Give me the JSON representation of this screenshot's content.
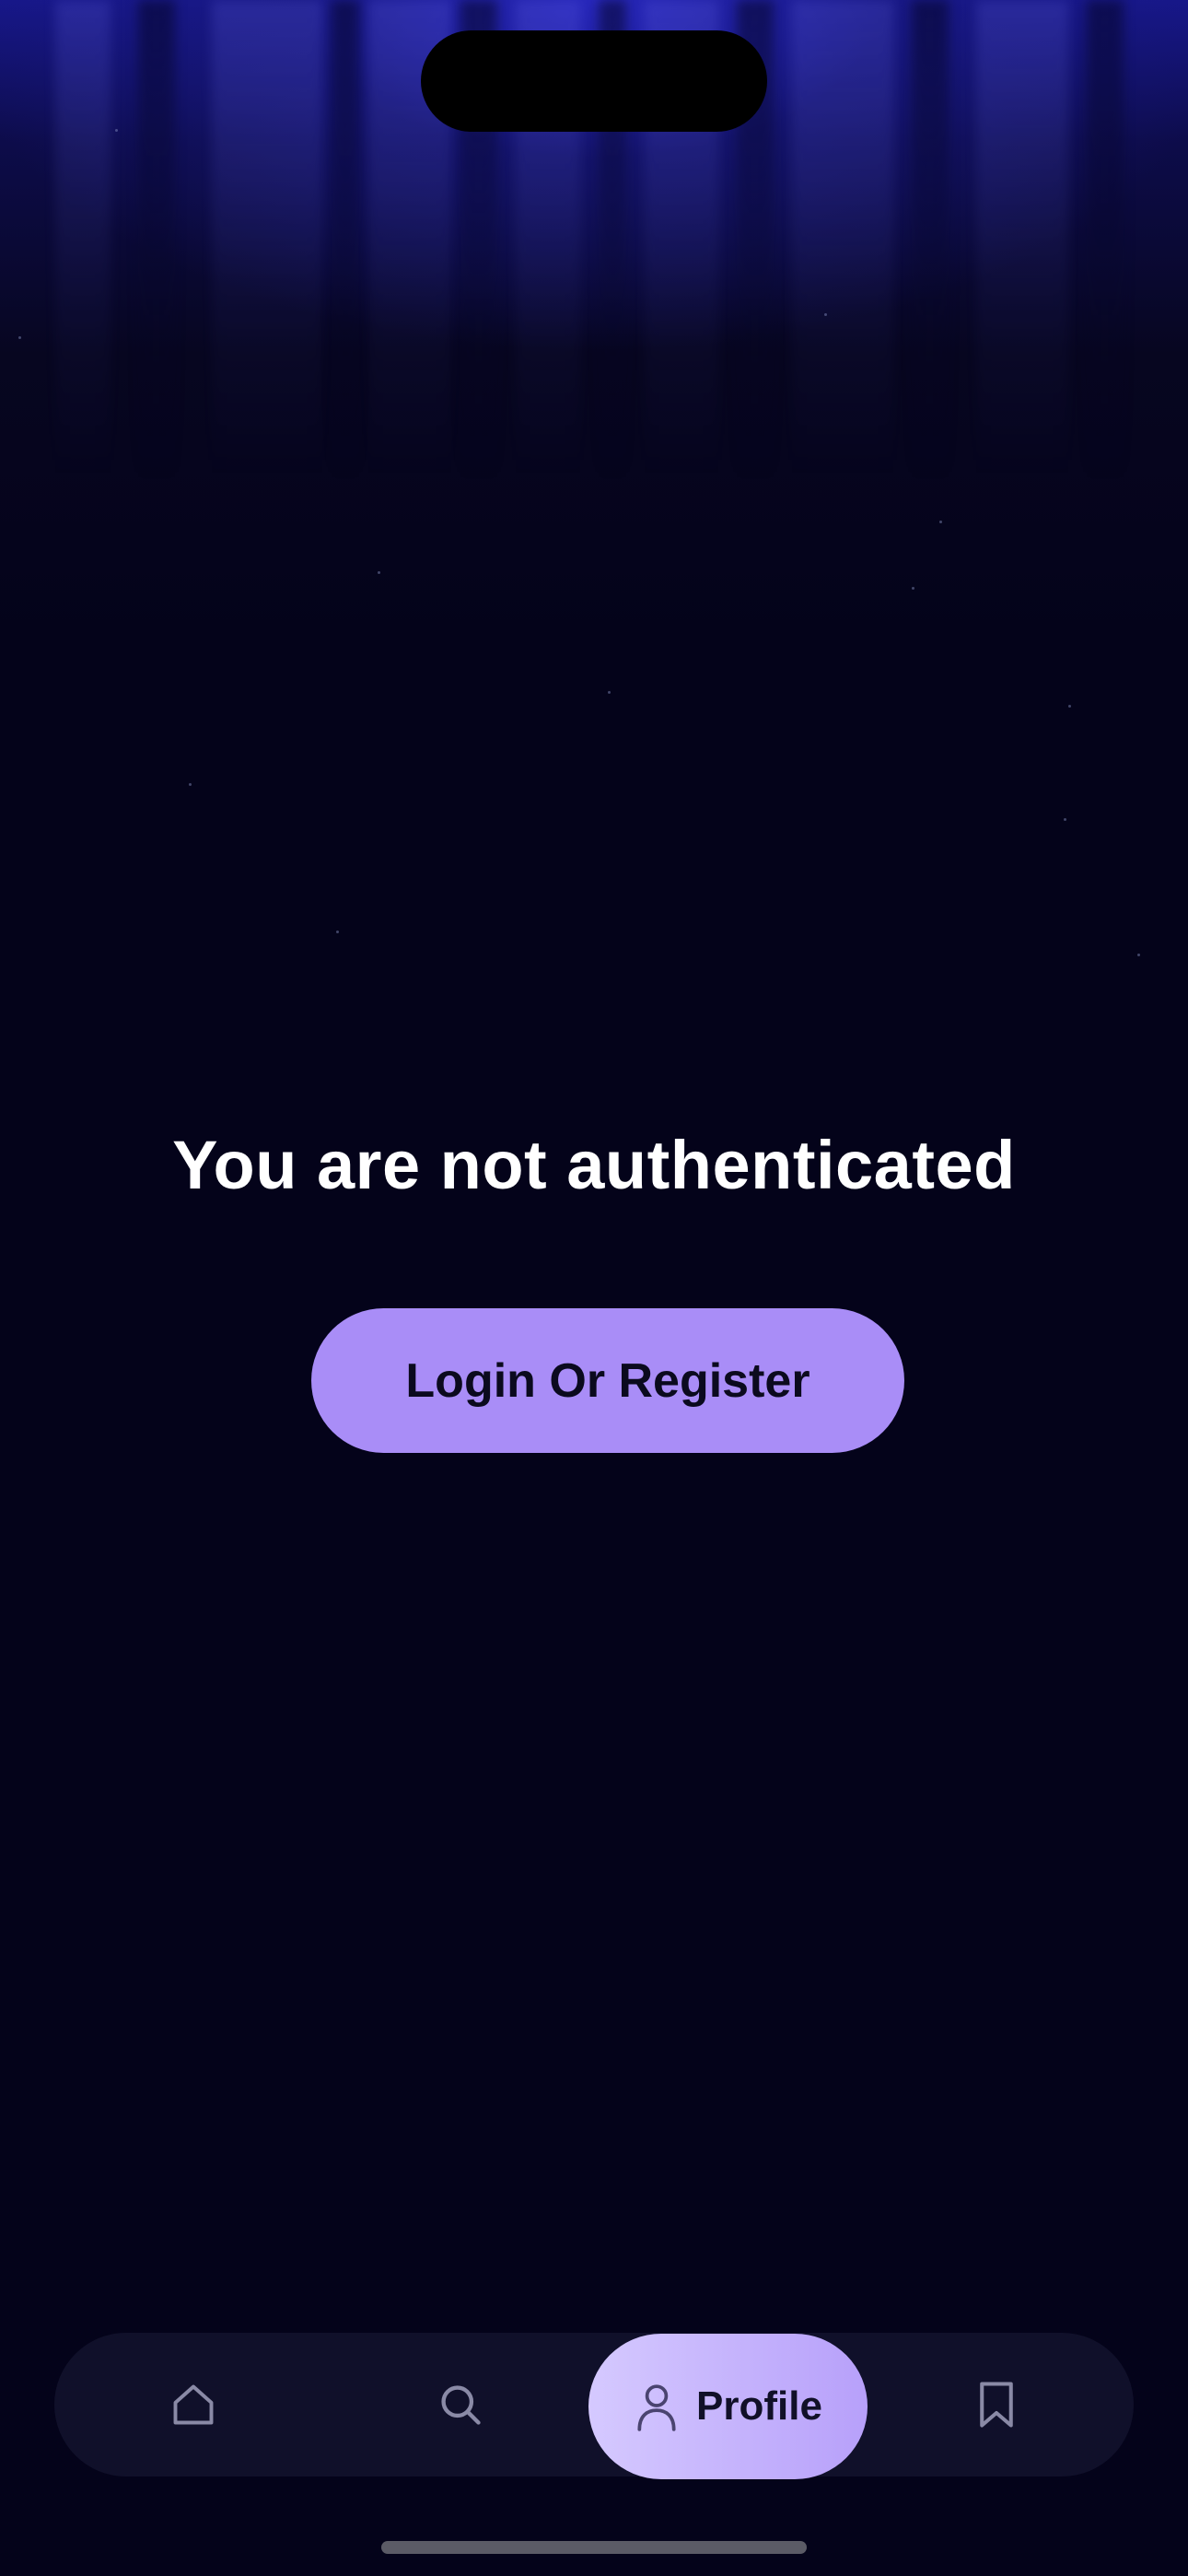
{
  "main": {
    "headline": "You are not authenticated",
    "login_button_label": "Login Or Register"
  },
  "tabbar": {
    "items": [
      {
        "id": "home",
        "label": "",
        "icon": "home-icon",
        "selected": false
      },
      {
        "id": "search",
        "label": "",
        "icon": "search-icon",
        "selected": false
      },
      {
        "id": "profile",
        "label": "Profile",
        "icon": "person-icon",
        "selected": true
      },
      {
        "id": "bookmarks",
        "label": "",
        "icon": "bookmark-icon",
        "selected": false
      }
    ]
  },
  "colors": {
    "background": "#04031a",
    "top_glow": "#17178a",
    "accent": "#a98df7",
    "tabbar": "#10102a"
  }
}
